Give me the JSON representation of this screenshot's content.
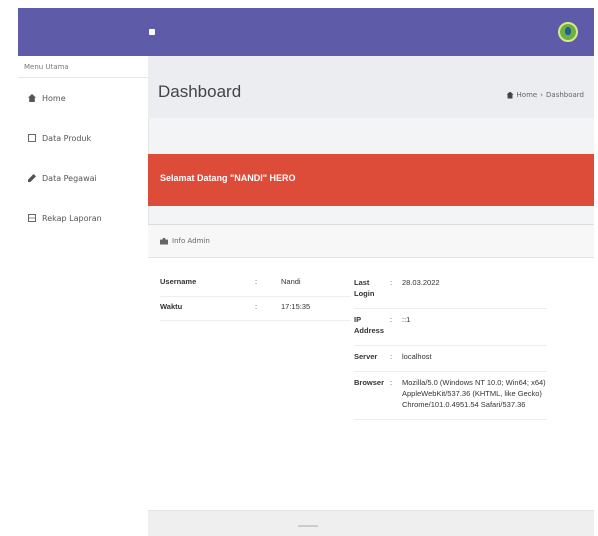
{
  "sidebar": {
    "menu_title": "Menu Utama",
    "items": [
      {
        "label": "Home",
        "icon": "home-icon"
      },
      {
        "label": "Data Produk",
        "icon": "document-icon"
      },
      {
        "label": "Data Pegawai",
        "icon": "pencil-icon"
      },
      {
        "label": "Rekap Laporan",
        "icon": "list-icon"
      }
    ]
  },
  "header": {
    "page_title": "Dashboard",
    "breadcrumb": {
      "home": "Home",
      "separator": "›",
      "current": "Dashboard"
    }
  },
  "welcome": {
    "text": "Selamat Datang \"NANDI\" HERO",
    "color": "#dd4b39"
  },
  "info_admin": {
    "title": "Info Admin",
    "left": [
      {
        "key": "Username",
        "value": "Nandi"
      },
      {
        "key": "Waktu",
        "value": "17:15:35"
      }
    ],
    "right": [
      {
        "key": "Last Login",
        "value": "28.03.2022"
      },
      {
        "key": "IP Address",
        "value": "::1"
      },
      {
        "key": "Server",
        "value": "localhost"
      },
      {
        "key": "Browser",
        "value": "Mozilla/5.0 (Windows NT 10.0; Win64; x64) AppleWebKit/537.36 (KHTML, like Gecko) Chrome/101.0.4951.54 Safari/537.36"
      }
    ],
    "separator": ":"
  },
  "colors": {
    "topbar": "#5e5ca8",
    "accent_red": "#dd4b39"
  }
}
